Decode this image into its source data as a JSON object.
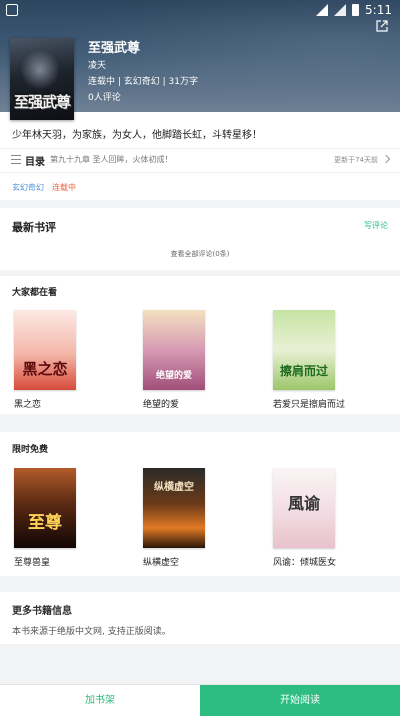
{
  "status_bar": {
    "time": "5:11"
  },
  "book": {
    "title": "至强武尊",
    "author": "凌天",
    "meta": "连载中 | 玄幻奇幻 | 31万字",
    "review_count": "0人评论",
    "cover_text": "至强武尊",
    "tagline": "少年林天羽，为家族，为女人，他脚踏长虹，斗转星移！"
  },
  "toc": {
    "label": "目录",
    "latest_chapter": "第九十九章 圣人回眸，火体初成！",
    "updated": "更新于74天前"
  },
  "tags": [
    "玄幻奇幻",
    "连载中"
  ],
  "reviews": {
    "section_title": "最新书评",
    "write_label": "写评论",
    "view_all": "查看全部评论(0条)"
  },
  "popular": {
    "section_title": "大家都在看",
    "items": [
      {
        "title": "黑之恋",
        "cover_text": "黑之恋"
      },
      {
        "title": "绝望的爱",
        "cover_text": "绝望的爱"
      },
      {
        "title": "若爱只是擦肩而过",
        "cover_text": "擦肩而过"
      }
    ]
  },
  "free": {
    "section_title": "限时免费",
    "items": [
      {
        "title": "至尊兽皇",
        "cover_text": "至尊"
      },
      {
        "title": "纵横虚空",
        "cover_text": "纵横虚空"
      },
      {
        "title": "风谕：倾城医女",
        "cover_text": "風谕"
      }
    ]
  },
  "more_info": {
    "title": "更多书籍信息",
    "body": "本书来源于绝版中文网, 支持正版阅读。"
  },
  "bottom_bar": {
    "add_shelf": "加书架",
    "start_reading": "开始阅读"
  },
  "colors": {
    "accent": "#2dbd83",
    "tag_blue": "#4a90d9",
    "tag_orange": "#e8663d"
  },
  "icons": [
    "app-notification-icon",
    "signal-icon",
    "battery-icon",
    "share-icon",
    "list-icon",
    "chevron-right-icon"
  ]
}
